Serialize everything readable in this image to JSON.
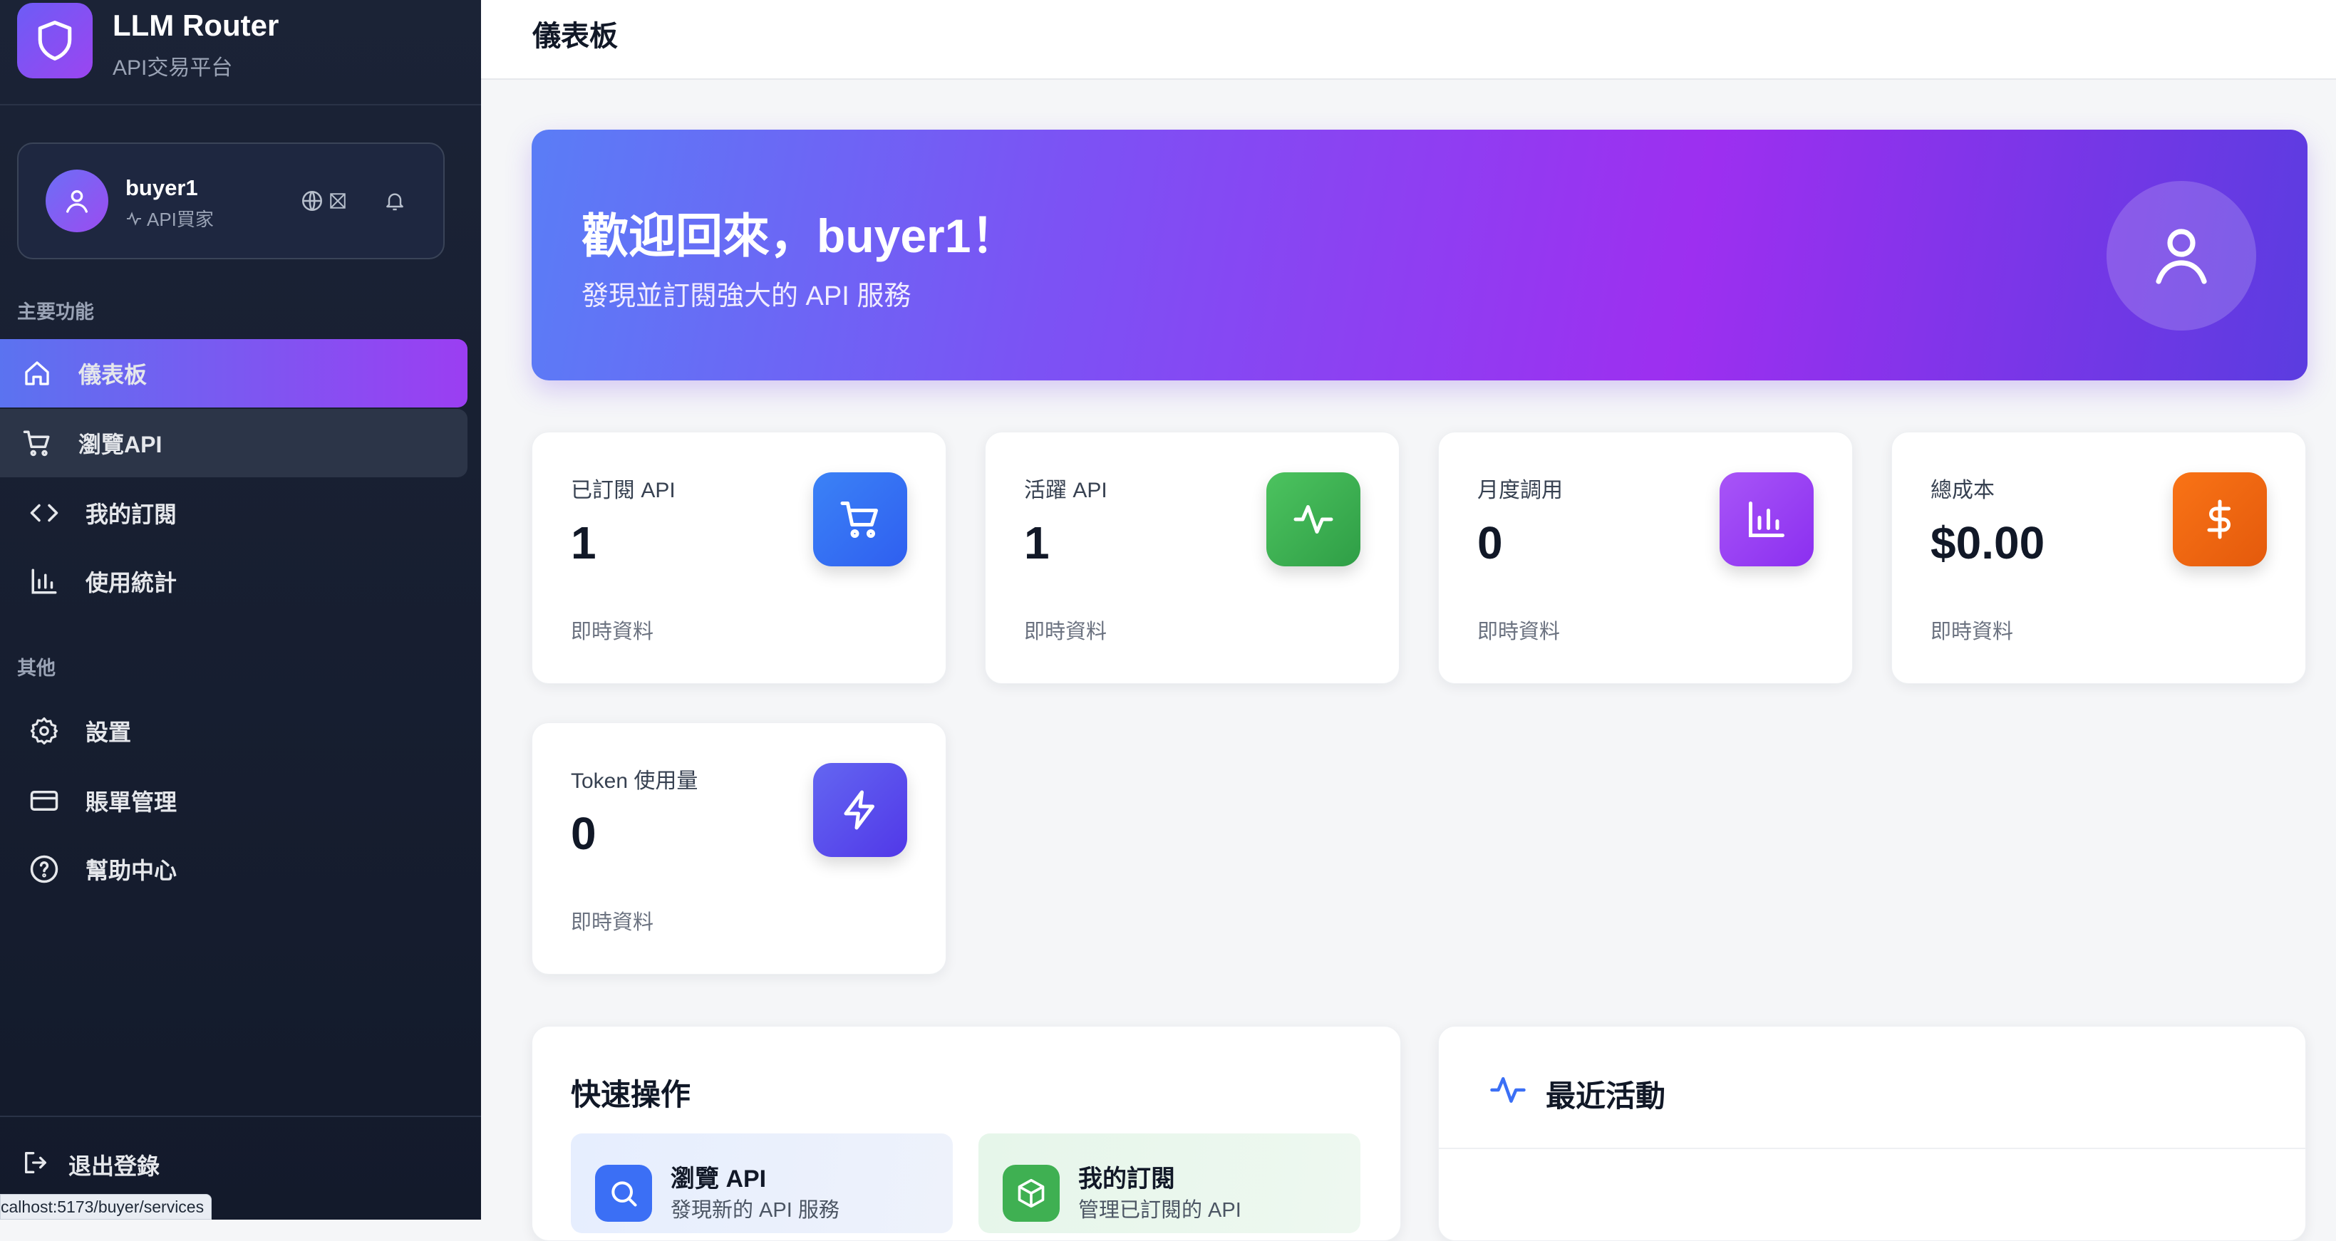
{
  "brand": {
    "name": "LLM Router",
    "subtitle": "API交易平台"
  },
  "user": {
    "name": "buyer1",
    "role": "API買家"
  },
  "sidebar": {
    "main_section_title": "主要功能",
    "main_items": [
      {
        "label": "儀表板",
        "icon": "home-icon",
        "state": "active"
      },
      {
        "label": "瀏覽API",
        "icon": "cart-icon",
        "state": "hover"
      },
      {
        "label": "我的訂閱",
        "icon": "code-icon",
        "state": "normal"
      },
      {
        "label": "使用統計",
        "icon": "bar-chart-icon",
        "state": "normal"
      }
    ],
    "other_section_title": "其他",
    "other_items": [
      {
        "label": "設置",
        "icon": "gear-icon"
      },
      {
        "label": "賬單管理",
        "icon": "credit-card-icon"
      },
      {
        "label": "幫助中心",
        "icon": "help-circle-icon"
      }
    ],
    "logout_label": "退出登錄"
  },
  "status_url": "calhost:5173/buyer/services",
  "header": {
    "title": "儀表板"
  },
  "hero": {
    "title": "歡迎回來，buyer1！",
    "subtitle": "發現並訂閱強大的 API 服務"
  },
  "stats": [
    {
      "label": "已訂閱 API",
      "value": "1",
      "foot": "即時資料",
      "icon": "cart-icon",
      "color": "#3b6ff5"
    },
    {
      "label": "活躍 API",
      "value": "1",
      "foot": "即時資料",
      "icon": "activity-icon",
      "color": "#3fb052"
    },
    {
      "label": "月度調用",
      "value": "0",
      "foot": "即時資料",
      "icon": "bar-chart-icon",
      "color": "#9b3ef2"
    },
    {
      "label": "總成本",
      "value": "$0.00",
      "foot": "即時資料",
      "icon": "dollar-icon",
      "color": "#f06a12"
    },
    {
      "label": "Token 使用量",
      "value": "0",
      "foot": "即時資料",
      "icon": "lightning-icon",
      "color": "#5b4cf0"
    }
  ],
  "quick_actions": {
    "title": "快速操作",
    "items": [
      {
        "title": "瀏覽 API",
        "subtitle": "發現新的 API 服務",
        "icon": "search-icon",
        "color": "#3b6ff5"
      },
      {
        "title": "我的訂閱",
        "subtitle": "管理已訂閱的 API",
        "icon": "package-icon",
        "color": "#3fb052"
      }
    ]
  },
  "recent_activity": {
    "title": "最近活動",
    "icon": "activity-icon"
  },
  "colors": {
    "accent_start": "#5b73f0",
    "accent_end": "#9b3ef2",
    "sidebar_bg": "#1b2336"
  }
}
